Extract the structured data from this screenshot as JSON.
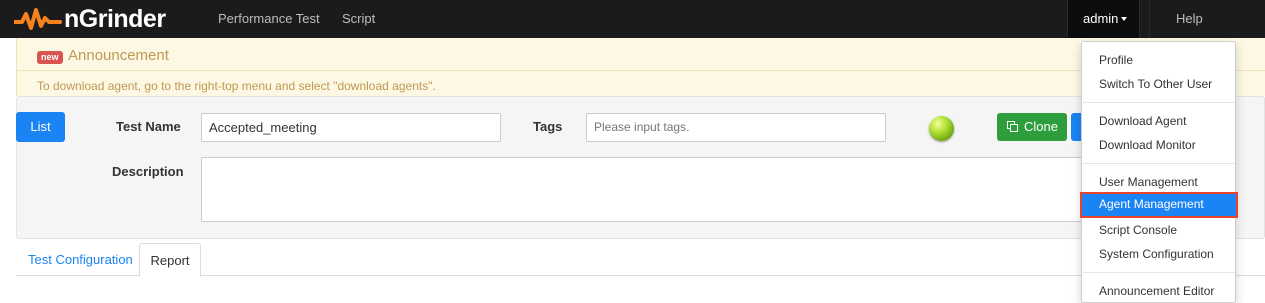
{
  "navbar": {
    "brand": "nGrinder",
    "links": [
      "Performance Test",
      "Script"
    ],
    "user_menu_label": "admin",
    "help_label": "Help"
  },
  "announcement": {
    "badge": "new",
    "title": "Announcement",
    "body": "To download agent, go to the right-top menu and select \"download agents\"."
  },
  "form": {
    "list_button": "List",
    "test_name_label": "Test Name",
    "test_name_value": "Accepted_meeting",
    "tags_label": "Tags",
    "tags_placeholder": "Please input tags.",
    "description_label": "Description",
    "description_value": "",
    "clone_button": "Clone",
    "status_color": "#9acd32"
  },
  "tabs": {
    "items": [
      "Test Configuration",
      "Report"
    ],
    "active": "Report"
  },
  "user_dropdown": {
    "groups": [
      [
        "Profile",
        "Switch To Other User"
      ],
      [
        "Download Agent",
        "Download Monitor"
      ],
      [
        "User Management",
        "Agent Management",
        "Script Console",
        "System Configuration"
      ],
      [
        "Announcement Editor"
      ]
    ],
    "selected": "Agent Management"
  },
  "colors": {
    "navbar_bg": "#1b1b1b",
    "primary": "#1b84f5",
    "success": "#2e9e3c",
    "announce_bg": "#fcf8e3",
    "announce_text": "#c09853",
    "highlight_border": "#e8452a",
    "logo_orange": "#f5821f"
  }
}
